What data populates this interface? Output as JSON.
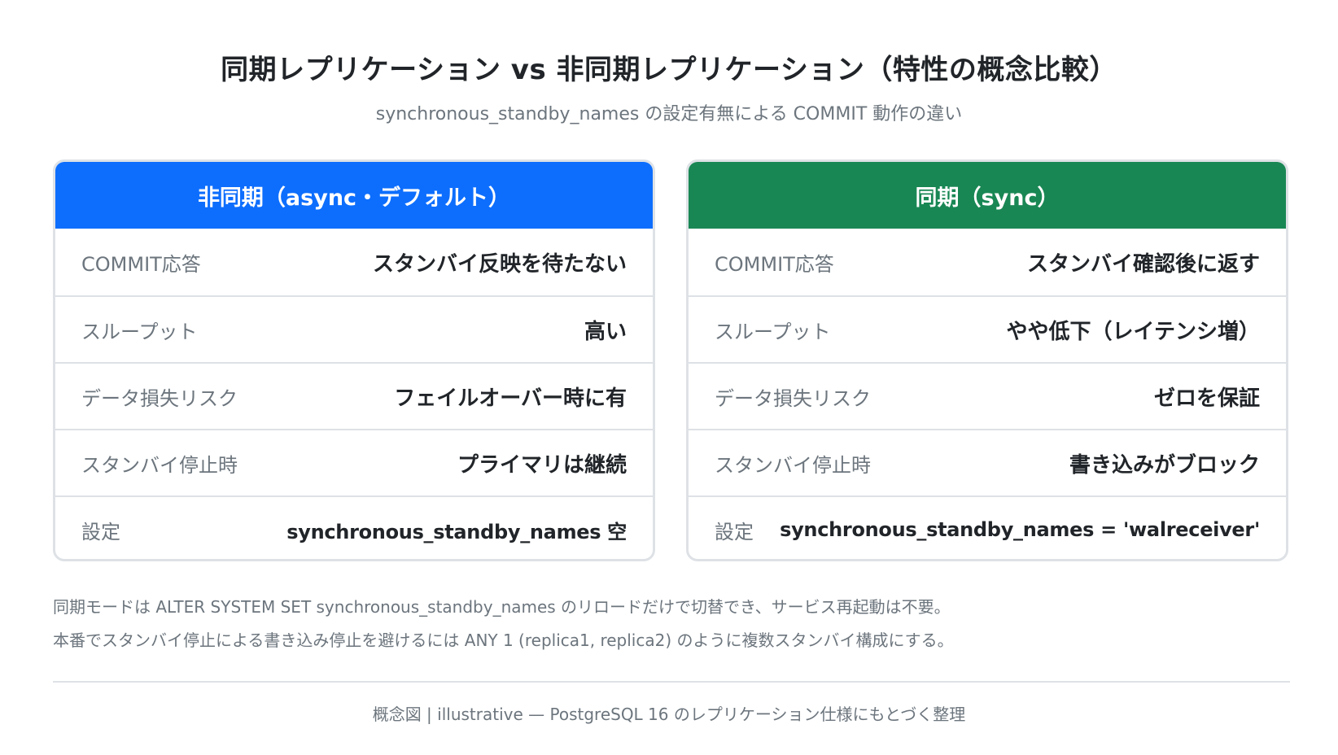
{
  "title": "同期レプリケーション vs 非同期レプリケーション（特性の概念比較）",
  "subtitle": "synchronous_standby_names の設定有無による COMMIT 動作の違い",
  "async_card": {
    "header": "非同期（async・デフォルト）",
    "color": "#0d6efd",
    "rows": [
      {
        "label": "COMMIT応答",
        "value": "スタンバイ反映を待たない"
      },
      {
        "label": "スループット",
        "value": "高い"
      },
      {
        "label": "データ損失リスク",
        "value": "フェイルオーバー時に有"
      },
      {
        "label": "スタンバイ停止時",
        "value": "プライマリは継続"
      },
      {
        "label": "設定",
        "value": "synchronous_standby_names 空"
      }
    ]
  },
  "sync_card": {
    "header": "同期（sync）",
    "color": "#198754",
    "rows": [
      {
        "label": "COMMIT応答",
        "value": "スタンバイ確認後に返す"
      },
      {
        "label": "スループット",
        "value": "やや低下（レイテンシ増）"
      },
      {
        "label": "データ損失リスク",
        "value": "ゼロを保証"
      },
      {
        "label": "スタンバイ停止時",
        "value": "書き込みがブロック"
      },
      {
        "label": "設定",
        "value": "synchronous_standby_names = 'walreceiver'"
      }
    ]
  },
  "notes": [
    "同期モードは ALTER SYSTEM SET synchronous_standby_names のリロードだけで切替でき、サービス再起動は不要。",
    "本番でスタンバイ停止による書き込み停止を避けるには ANY 1 (replica1, replica2) のように複数スタンバイ構成にする。"
  ],
  "footer": "概念図 | illustrative — PostgreSQL 16 のレプリケーション仕様にもとづく整理"
}
